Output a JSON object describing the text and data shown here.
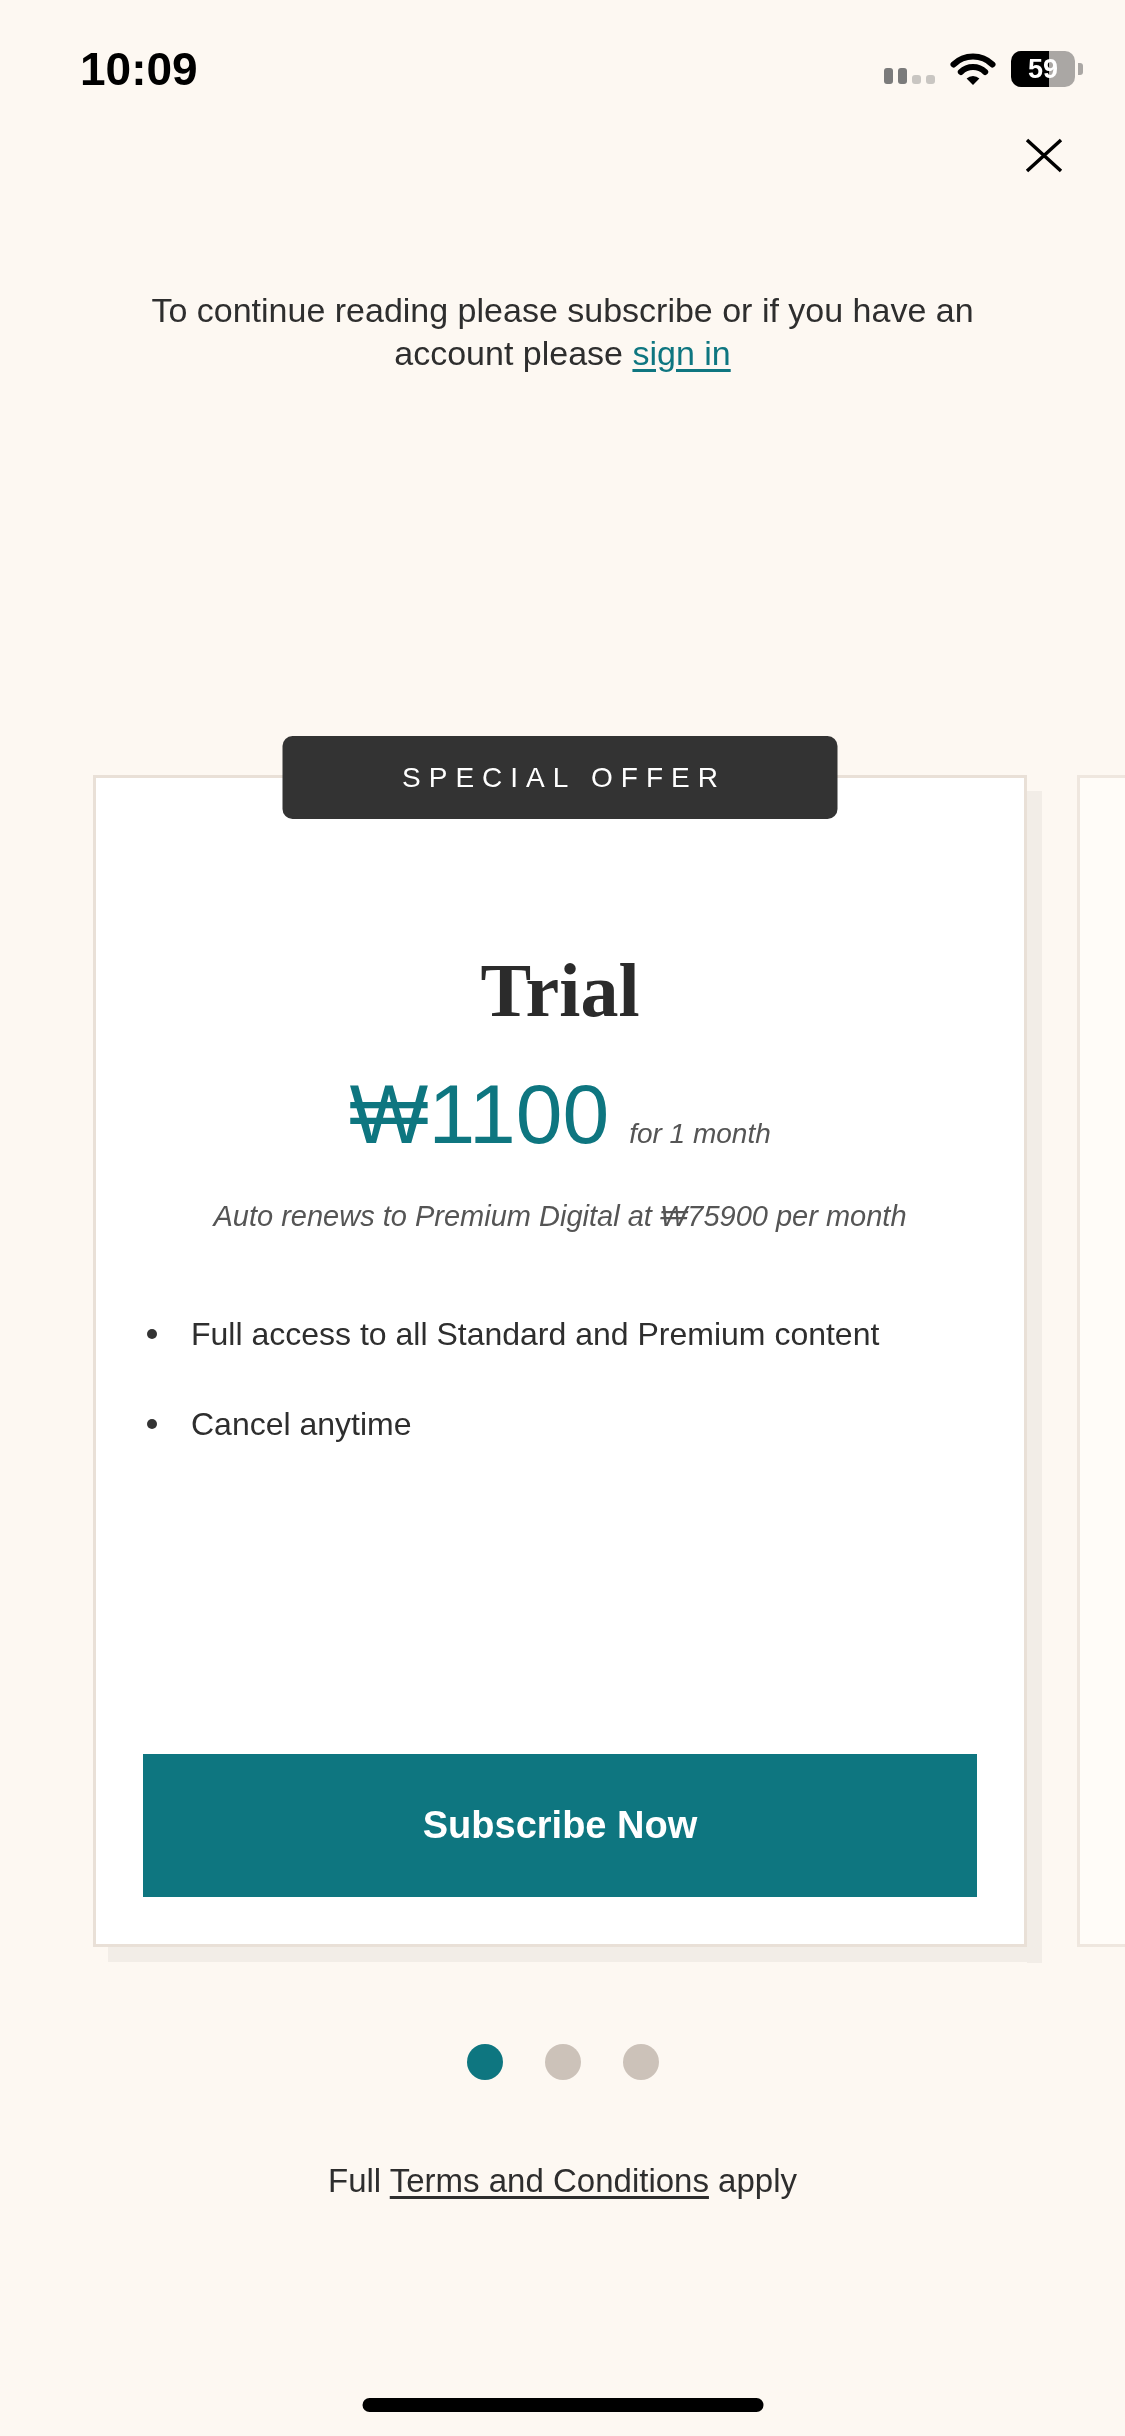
{
  "status_bar": {
    "time": "10:09",
    "battery": "59"
  },
  "prompt": {
    "text": "To continue reading please subscribe or if you have an account please",
    "link": "sign in"
  },
  "offer": {
    "badge": "SPECIAL OFFER",
    "title": "Trial",
    "price": "₩1100",
    "period": "for 1 month",
    "renewal": "Auto renews to Premium Digital at ₩75900 per month",
    "features": [
      "Full access to all Standard and Premium content",
      "Cancel anytime"
    ],
    "button": "Subscribe Now"
  },
  "pager": [
    {
      "selected": true
    },
    {
      "selected": false
    },
    {
      "selected": false
    }
  ],
  "terms": {
    "text_before": "Full",
    "link": "Terms and Conditions",
    "text_after": "apply"
  }
}
